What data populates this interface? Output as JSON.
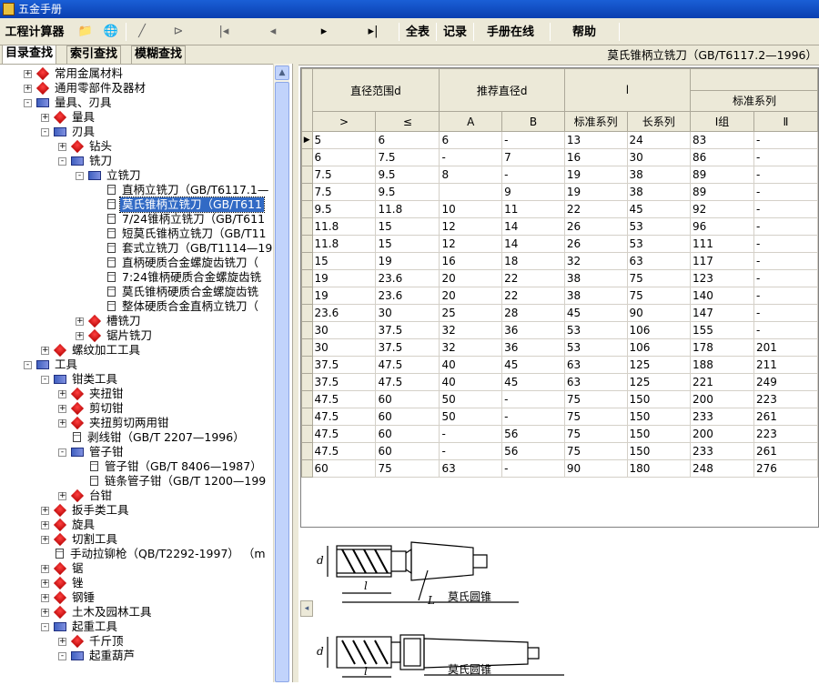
{
  "window": {
    "title": "五金手册"
  },
  "toolbar": {
    "calc_label": "工程计算器",
    "all_table_label": "全表",
    "record_label": "记录",
    "online_label": "手册在线",
    "help_label": "帮助"
  },
  "left_tabs": [
    "目录查找",
    "索引查找",
    "模糊查找"
  ],
  "tree": [
    "常用金属材料",
    "通用零部件及器材",
    "量具、刃具",
    "量具",
    "刃具",
    "钻头",
    "铣刀",
    "立铣刀",
    "直柄立铣刀（GB/T6117.1—",
    "莫氏锥柄立铣刀（GB/T611",
    "7/24锥柄立铣刀（GB/T611",
    "短莫氏锥柄立铣刀（GB/T11",
    "套式立铣刀（GB/T1114—19",
    "直柄硬质合金螺旋齿铣刀（",
    "7:24锥柄硬质合金螺旋齿铣",
    "莫氏锥柄硬质合金螺旋齿铣",
    "整体硬质合金直柄立铣刀（",
    "槽铣刀",
    "锯片铣刀",
    "螺纹加工工具",
    "工具",
    "钳类工具",
    "夹扭钳",
    "剪切钳",
    "夹扭剪切两用钳",
    "剥线钳（GB/T 2207—1996）",
    "管子钳",
    "管子钳（GB/T 8406—1987）",
    "链条管子钳（GB/T 1200—199",
    "台钳",
    "扳手类工具",
    "旋具",
    "切割工具",
    "手动拉铆枪（QB/T2292-1997）  （m",
    "锯",
    "锉",
    "钢锤",
    "土木及园林工具",
    "起重工具",
    "千斤顶",
    "起重葫芦"
  ],
  "content": {
    "title": "莫氏锥柄立铣刀（GB/T6117.2—1996）",
    "header_top": [
      "直径范围d",
      "推荐直径d",
      "l",
      "",
      "标准系列"
    ],
    "header_sub": [
      ">",
      "≤",
      "A",
      "B",
      "标准系列",
      "长系列",
      "Ⅰ组",
      "Ⅱ"
    ],
    "rows": [
      [
        "5",
        "6",
        "6",
        "-",
        "13",
        "24",
        "83",
        "-"
      ],
      [
        "6",
        "7.5",
        "-",
        "7",
        "16",
        "30",
        "86",
        "-"
      ],
      [
        "7.5",
        "9.5",
        "8",
        "-",
        "19",
        "38",
        "89",
        "-"
      ],
      [
        "7.5",
        "9.5",
        "",
        "9",
        "19",
        "38",
        "89",
        "-"
      ],
      [
        "9.5",
        "11.8",
        "10",
        "11",
        "22",
        "45",
        "92",
        "-"
      ],
      [
        "11.8",
        "15",
        "12",
        "14",
        "26",
        "53",
        "96",
        "-"
      ],
      [
        "11.8",
        "15",
        "12",
        "14",
        "26",
        "53",
        "111",
        "-"
      ],
      [
        "15",
        "19",
        "16",
        "18",
        "32",
        "63",
        "117",
        "-"
      ],
      [
        "19",
        "23.6",
        "20",
        "22",
        "38",
        "75",
        "123",
        "-"
      ],
      [
        "19",
        "23.6",
        "20",
        "22",
        "38",
        "75",
        "140",
        "-"
      ],
      [
        "23.6",
        "30",
        "25",
        "28",
        "45",
        "90",
        "147",
        "-"
      ],
      [
        "30",
        "37.5",
        "32",
        "36",
        "53",
        "106",
        "155",
        "-"
      ],
      [
        "30",
        "37.5",
        "32",
        "36",
        "53",
        "106",
        "178",
        "201"
      ],
      [
        "37.5",
        "47.5",
        "40",
        "45",
        "63",
        "125",
        "188",
        "211"
      ],
      [
        "37.5",
        "47.5",
        "40",
        "45",
        "63",
        "125",
        "221",
        "249"
      ],
      [
        "47.5",
        "60",
        "50",
        "-",
        "75",
        "150",
        "200",
        "223"
      ],
      [
        "47.5",
        "60",
        "50",
        "-",
        "75",
        "150",
        "233",
        "261"
      ],
      [
        "47.5",
        "60",
        "-",
        "56",
        "75",
        "150",
        "200",
        "223"
      ],
      [
        "47.5",
        "60",
        "-",
        "56",
        "75",
        "150",
        "233",
        "261"
      ],
      [
        "60",
        "75",
        "63",
        "-",
        "90",
        "180",
        "248",
        "276"
      ]
    ],
    "figure": {
      "label_taper": "莫氏圆锥",
      "label_d": "d",
      "label_l": "l",
      "label_L": "L"
    }
  }
}
